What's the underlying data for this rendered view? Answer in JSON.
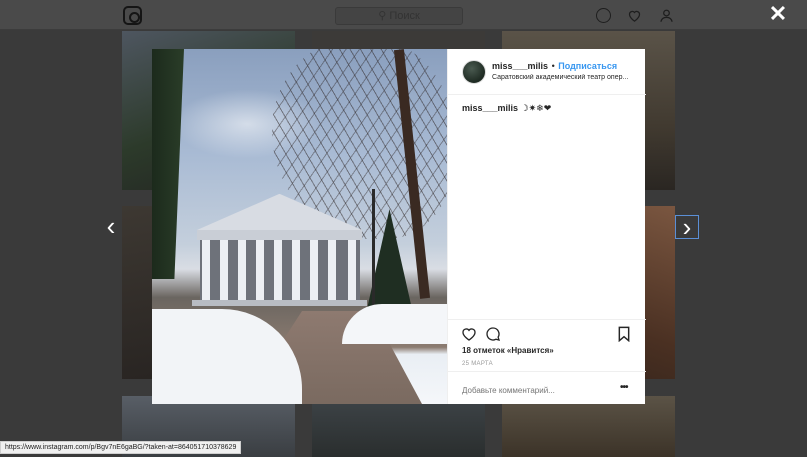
{
  "background": {
    "search_placeholder": "Поиск"
  },
  "modal": {
    "author": "miss___milis",
    "separator": "•",
    "follow_label": "Подписаться",
    "location": "Саратовский академический театр опер...",
    "caption_author": "miss___milis",
    "caption_text": "☽✷❄❤",
    "likes": "18 отметок «Нравится»",
    "date": "25 МАРТА",
    "comment_placeholder": "Добавьте комментарий...",
    "more_label": "•••"
  },
  "overlay": {
    "close_label": "✕",
    "prev_label": "‹",
    "next_label": "›"
  },
  "status_url": "https://www.instagram.com/p/Bgv7nE6gaBG/?taken-at=864051710378629",
  "colors": {
    "accent": "#3897f0",
    "overlay": "#3a3a3a"
  },
  "icons": [
    "instagram-logo-icon",
    "search-icon",
    "compass-icon",
    "heart-icon",
    "user-icon",
    "close-icon",
    "chevron-left-icon",
    "chevron-right-icon",
    "like-icon",
    "comment-icon",
    "bookmark-icon",
    "more-icon"
  ]
}
